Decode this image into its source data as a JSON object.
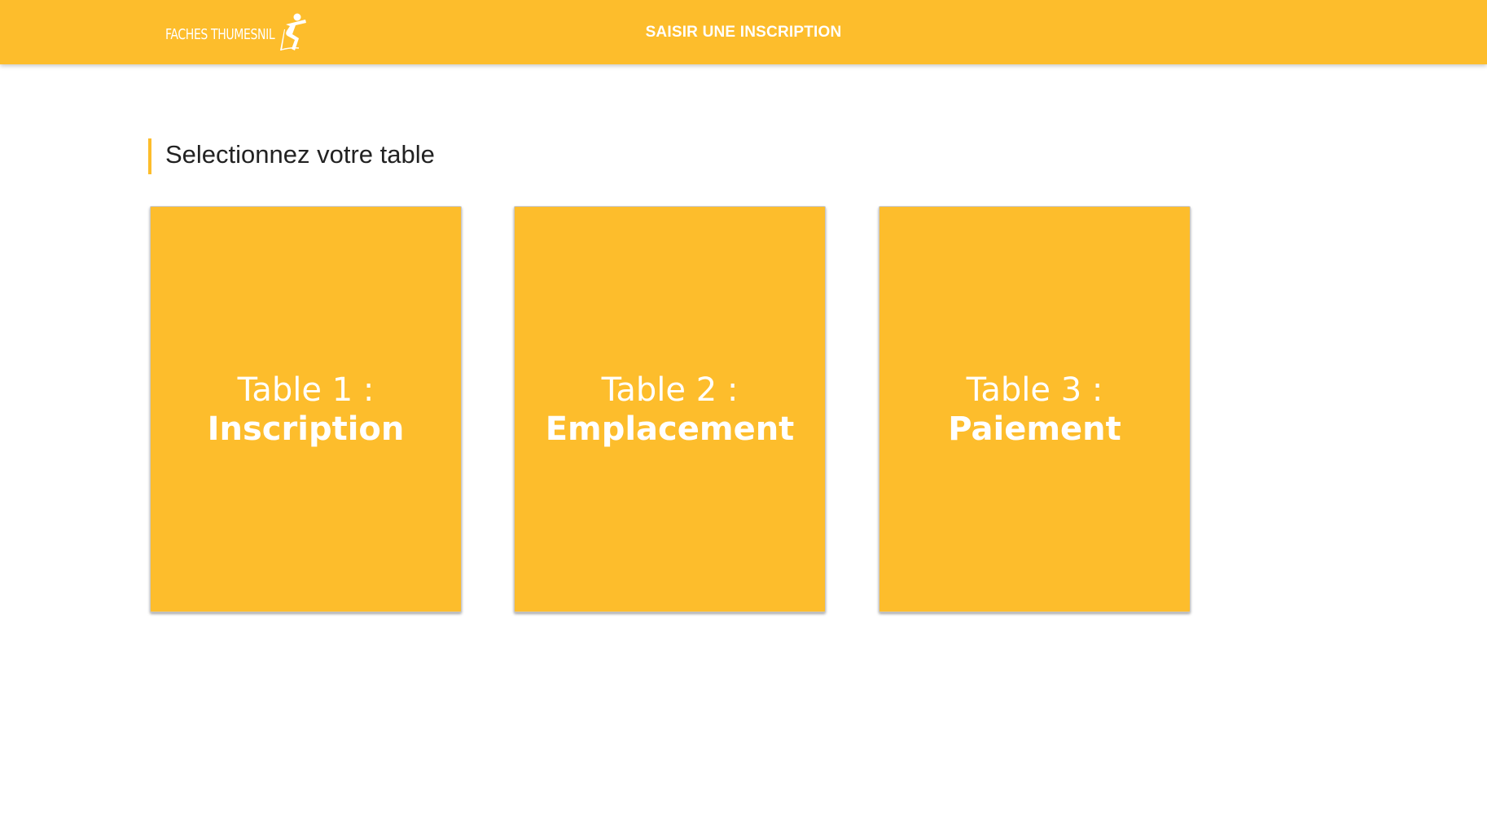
{
  "header": {
    "logo_text": "FACHES THUMESNIL",
    "logo_icon": "person-running-figure",
    "title": "SAISIR UNE INSCRIPTION",
    "background_color": "#FDBD2C"
  },
  "main": {
    "section_title": "Selectionnez votre table",
    "accent_color": "#FDBD2C",
    "tables": [
      {
        "line1": "Table 1 :",
        "line2": "Inscription"
      },
      {
        "line1": "Table 2 :",
        "line2": "Emplacement"
      },
      {
        "line1": "Table 3 :",
        "line2": "Paiement"
      }
    ]
  }
}
